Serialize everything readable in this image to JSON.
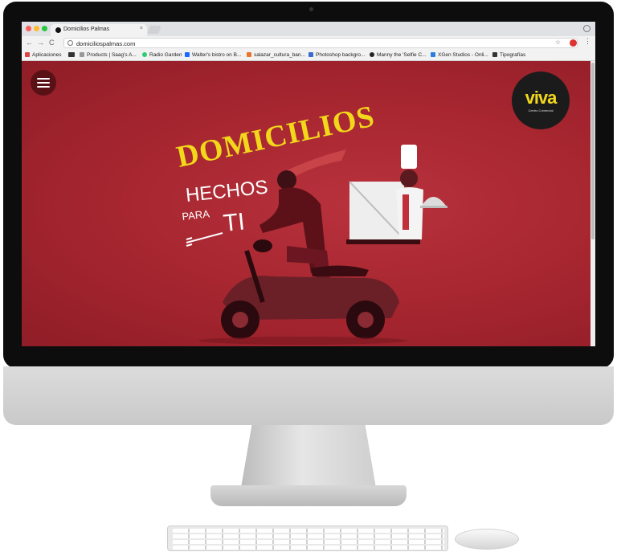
{
  "browser": {
    "tab_title": "Domicilios Palmas",
    "tab_close": "×",
    "url": "domiciliospalmas.com",
    "nav": {
      "back": "←",
      "forward": "→",
      "reload": "C"
    },
    "star": "☆",
    "menu": "⋮",
    "bookmarks": [
      {
        "label": "Aplicaciones",
        "icon": "apps-grid-icon",
        "color": "#d44"
      },
      {
        "label": "",
        "icon": "bookmark-dark-icon",
        "color": "#333"
      },
      {
        "label": "Products | Saag's A...",
        "icon": "saag-icon",
        "color": "#999"
      },
      {
        "label": "Radio Garden",
        "icon": "radio-garden-icon",
        "color": "#2ecc71"
      },
      {
        "label": "Walter's bistro on B...",
        "icon": "behance-icon",
        "color": "#1769ff"
      },
      {
        "label": "salazar_cultura_ban...",
        "icon": "image-icon",
        "color": "#e8742c"
      },
      {
        "label": "Photoshop backgro...",
        "icon": "pen-icon",
        "color": "#3a6ccf"
      },
      {
        "label": "Manny the 'Selfie C...",
        "icon": "manny-icon",
        "color": "#222"
      },
      {
        "label": "XGen Studios - Onli...",
        "icon": "xgen-icon",
        "color": "#2a7de1"
      },
      {
        "label": "Tipografías",
        "icon": "typography-icon",
        "color": "#333"
      }
    ]
  },
  "page": {
    "logo_word": "viva",
    "logo_sub": "Centro Comercial",
    "headline": "DOMICILIOS",
    "subline_1": "HECHOS",
    "subline_2": "PARA",
    "subline_3": "TI"
  },
  "colors": {
    "background_red": "#a5252f",
    "headline_yellow": "#f2d81b",
    "logo_yellow": "#f2d81b",
    "logo_dark": "#1b1b1b",
    "menu_button": "#5a1116"
  }
}
